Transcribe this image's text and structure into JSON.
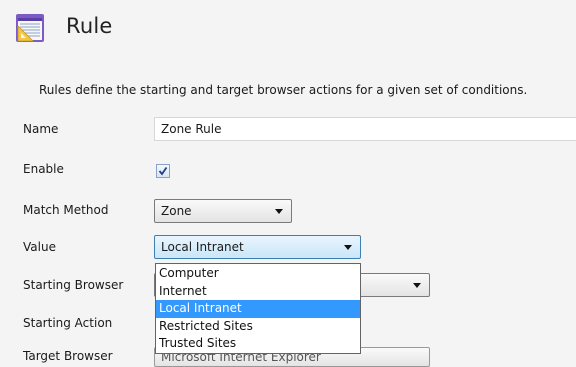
{
  "header": {
    "title": "Rule",
    "icon": "rule-document-icon"
  },
  "description": "Rules define the starting and target browser actions for a given set of conditions.",
  "form": {
    "name": {
      "label": "Name",
      "value": "Zone Rule"
    },
    "enable": {
      "label": "Enable",
      "checked": true
    },
    "match_method": {
      "label": "Match Method",
      "value": "Zone"
    },
    "value": {
      "label": "Value",
      "selected": "Local Intranet",
      "options": [
        "Computer",
        "Internet",
        "Local Intranet",
        "Restricted Sites",
        "Trusted Sites"
      ]
    },
    "starting_browser": {
      "label": "Starting Browser"
    },
    "starting_action": {
      "label": "Starting Action"
    },
    "target_browser": {
      "label": "Target Browser",
      "value": "Microsoft Internet Explorer"
    }
  },
  "colors": {
    "highlight": "#3399ff",
    "active_select_border": "#3c7fb1",
    "background": "#f4f4f4"
  }
}
